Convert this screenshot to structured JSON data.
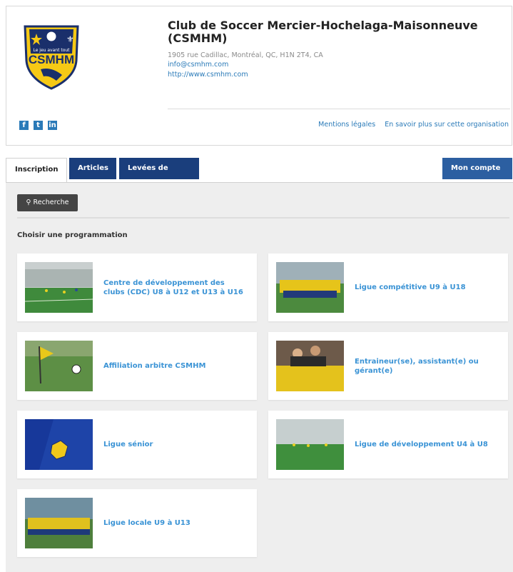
{
  "org": {
    "name": "Club de Soccer Mercier-Hochelaga-Maisonneuve (CSMHM)",
    "address": "1905 rue Cadillac, Montréal, QC, H1N 2T4, CA",
    "email": "info@csmhm.com",
    "website": "http://www.csmhm.com",
    "logo_text": "CSMHM",
    "logo_tagline": "Le jeu avant tout"
  },
  "social": {
    "facebook": "f",
    "twitter": "t",
    "linkedin": "in"
  },
  "footer_links": {
    "legal": "Mentions légales",
    "more": "En savoir plus sur cette organisation"
  },
  "tabs": {
    "inscription": "Inscription",
    "articles": "Articles",
    "fonds": "Levées de fonds",
    "account": "Mon compte"
  },
  "search_label": "Recherche",
  "section_title": "Choisir une programmation",
  "programs": [
    {
      "label": "Centre de développement des clubs (CDC) U8 à U12 et U13 à U16"
    },
    {
      "label": "Ligue compétitive U9 à U18"
    },
    {
      "label": "Affiliation arbitre CSMHM"
    },
    {
      "label": "Entraineur(se), assistant(e) ou gérant(e)"
    },
    {
      "label": "Ligue sénior"
    },
    {
      "label": "Ligue de développement U4 à U8"
    },
    {
      "label": "Ligue locale U9 à U13"
    }
  ],
  "colors": {
    "link": "#2a7ab8",
    "card_title": "#3a93d5",
    "tab_dark": "#1a3e7c",
    "account": "#2c5fa1"
  }
}
